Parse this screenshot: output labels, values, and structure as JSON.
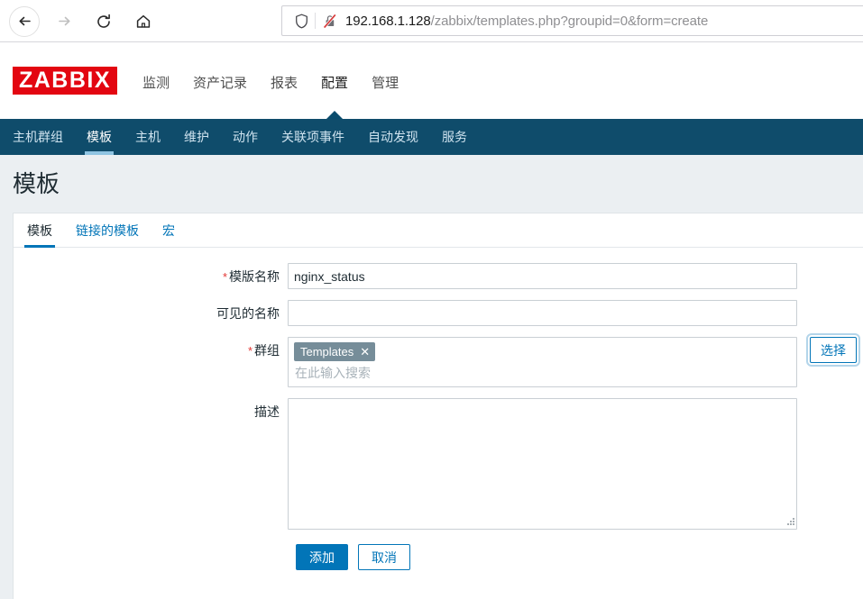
{
  "browser": {
    "back_label": "back-arrow",
    "forward_label": "forward-arrow",
    "reload_label": "reload",
    "home_label": "home",
    "url_host": "192.168.1.128",
    "url_path": "/zabbix/templates.php?groupid=0&form=create",
    "shield_icon": "tracking-protection-shield-icon",
    "lock_icon": "insecure-connection-icon"
  },
  "header": {
    "logo": "ZABBIX",
    "logo_color": "#e30611",
    "nav": [
      {
        "label": "监测",
        "active": false
      },
      {
        "label": "资产记录",
        "active": false
      },
      {
        "label": "报表",
        "active": false
      },
      {
        "label": "配置",
        "active": true
      },
      {
        "label": "管理",
        "active": false
      }
    ]
  },
  "subnav": {
    "bg_color": "#0f4c6b",
    "items": [
      {
        "label": "主机群组",
        "active": false
      },
      {
        "label": "模板",
        "active": true
      },
      {
        "label": "主机",
        "active": false
      },
      {
        "label": "维护",
        "active": false
      },
      {
        "label": "动作",
        "active": false
      },
      {
        "label": "关联项事件",
        "active": false
      },
      {
        "label": "自动发现",
        "active": false
      },
      {
        "label": "服务",
        "active": false
      }
    ]
  },
  "page": {
    "title": "模板",
    "tabs": [
      {
        "label": "模板",
        "active": true
      },
      {
        "label": "链接的模板",
        "active": false
      },
      {
        "label": "宏",
        "active": false
      }
    ]
  },
  "form": {
    "accent_color": "#0275b8",
    "required_marker": "*",
    "template_name": {
      "label": "模版名称",
      "value": "nginx_status",
      "required": true
    },
    "visible_name": {
      "label": "可见的名称",
      "value": "",
      "required": false
    },
    "groups": {
      "label": "群组",
      "required": true,
      "chips": [
        {
          "label": "Templates",
          "remove_icon": "✕"
        }
      ],
      "search_placeholder": "在此输入搜索",
      "select_button": "选择"
    },
    "description": {
      "label": "描述",
      "value": ""
    },
    "buttons": {
      "submit": "添加",
      "cancel": "取消"
    }
  }
}
